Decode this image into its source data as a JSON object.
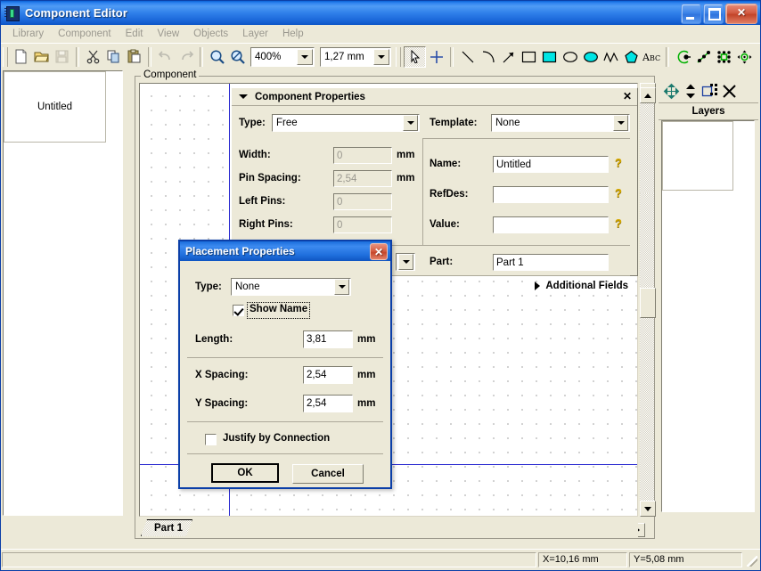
{
  "window": {
    "title": "Component Editor",
    "icon": "chip-icon",
    "minimize_label": "_",
    "maximize_label": "□",
    "close_label": "✕"
  },
  "menubar": {
    "items": [
      {
        "label": "Library"
      },
      {
        "label": "Component"
      },
      {
        "label": "Edit"
      },
      {
        "label": "View"
      },
      {
        "label": "Objects"
      },
      {
        "label": "Layer"
      },
      {
        "label": "Help"
      }
    ]
  },
  "toolbar": {
    "zoom_value": "400%",
    "grid_value": "1,27 mm",
    "buttons": [
      {
        "name": "new-file-icon"
      },
      {
        "name": "open-folder-icon"
      },
      {
        "name": "save-icon"
      },
      {
        "name": "cut-scissors-icon"
      },
      {
        "name": "copy-icon"
      },
      {
        "name": "paste-icon"
      },
      {
        "name": "undo-icon"
      },
      {
        "name": "redo-icon"
      },
      {
        "name": "zoom-in-icon"
      },
      {
        "name": "zoom-out-icon"
      }
    ],
    "draw_tools": [
      {
        "name": "select-arrow-icon"
      },
      {
        "name": "crosshair-icon"
      },
      {
        "name": "line-icon"
      },
      {
        "name": "arc-icon"
      },
      {
        "name": "arrow-icon"
      },
      {
        "name": "rectangle-icon"
      },
      {
        "name": "filled-rectangle-icon"
      },
      {
        "name": "ellipse-icon"
      },
      {
        "name": "filled-ellipse-icon"
      },
      {
        "name": "polyline-icon"
      },
      {
        "name": "polygon-icon"
      },
      {
        "name": "text-icon"
      }
    ],
    "pin_tools": [
      {
        "name": "pin-icon"
      },
      {
        "name": "pin-row-icon"
      },
      {
        "name": "pin-grid-icon"
      },
      {
        "name": "pin-place-icon"
      }
    ]
  },
  "left_panel": {
    "item_label": "Untitled"
  },
  "component_group": {
    "label": "Component"
  },
  "component_properties": {
    "title": "Component Properties",
    "close_label": "✕",
    "type_label": "Type:",
    "type_value": "Free",
    "width_label": "Width:",
    "width_value": "0",
    "width_unit": "mm",
    "pin_spacing_label": "Pin Spacing:",
    "pin_spacing_value": "2,54",
    "pin_spacing_unit": "mm",
    "left_pins_label": "Left Pins:",
    "left_pins_value": "0",
    "right_pins_label": "Right Pins:",
    "right_pins_value": "0",
    "template_label": "Template:",
    "template_value": "None",
    "name_label": "Name:",
    "name_value": "Untitled",
    "refdes_label": "RefDes:",
    "refdes_value": "",
    "value_label": "Value:",
    "value_value": "",
    "part_label": "Part:",
    "part_value": "Part 1",
    "additional_fields_label": "Additional Fields",
    "help_glyph": "?"
  },
  "layers_dock": {
    "title": "Layers",
    "tools": [
      {
        "name": "move-layer-icon"
      },
      {
        "name": "reorder-layer-icon"
      },
      {
        "name": "new-layer-icon"
      },
      {
        "name": "delete-layer-icon"
      }
    ]
  },
  "tabs": {
    "items": [
      {
        "label": "Part 1"
      }
    ]
  },
  "dialog": {
    "title": "Placement Properties",
    "close_label": "✕",
    "type_label": "Type:",
    "type_value": "None",
    "show_name_label": "Show Name",
    "show_name_checked": true,
    "length_label": "Length:",
    "length_value": "3,81",
    "length_unit": "mm",
    "x_spacing_label": "X Spacing:",
    "x_spacing_value": "2,54",
    "x_spacing_unit": "mm",
    "y_spacing_label": "Y Spacing:",
    "y_spacing_value": "2,54",
    "y_spacing_unit": "mm",
    "justify_label": "Justify by Connection",
    "justify_checked": false,
    "ok_label": "OK",
    "cancel_label": "Cancel"
  },
  "statusbar": {
    "x_coord": "X=10,16 mm",
    "y_coord": "Y=5,08 mm"
  },
  "colors": {
    "titlebar_blue": "#1f6fdd",
    "dialog_border": "#0b3fa8",
    "face": "#ece9d8",
    "axis_blue": "#2b2bd0",
    "accent_cyan": "#00e5e5",
    "accent_green": "#00c000"
  }
}
